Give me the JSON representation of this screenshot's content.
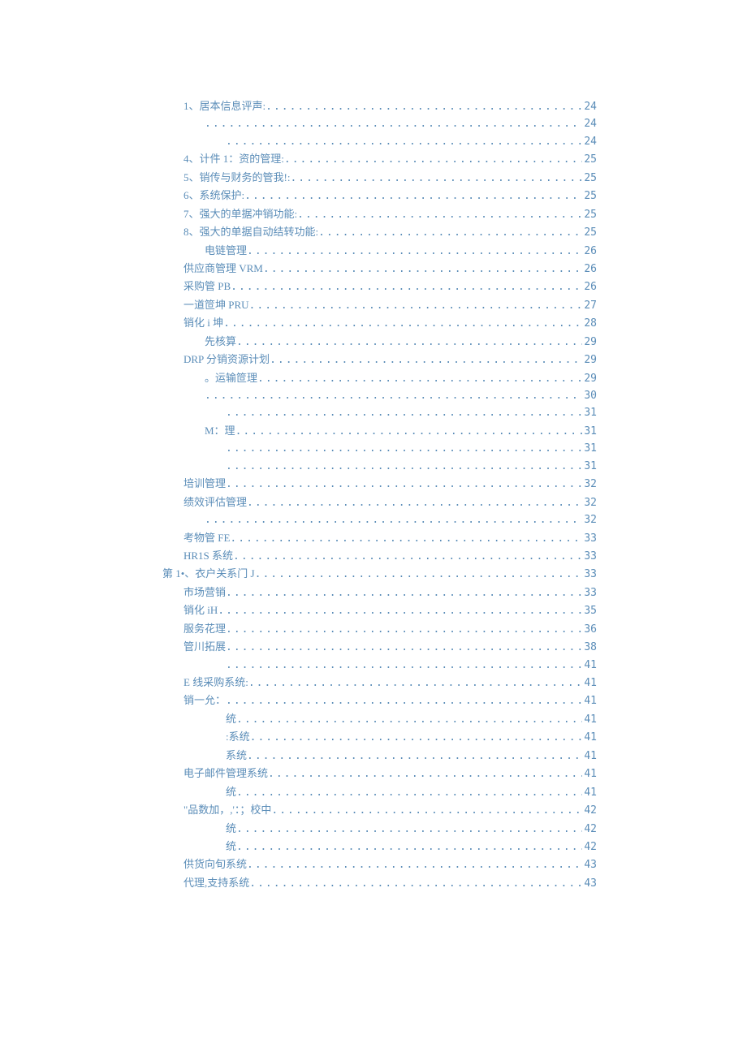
{
  "toc": [
    {
      "label": "1、居本信息评声:",
      "page": "24",
      "indent": 1
    },
    {
      "label": "",
      "page": "24",
      "indent": 2
    },
    {
      "label": "",
      "page": "24",
      "indent": 3
    },
    {
      "label": "4、计件 1：资的管理:",
      "page": "25",
      "indent": 1
    },
    {
      "label": "5、销传与财务的管我!:",
      "page": "25",
      "indent": 1
    },
    {
      "label": "6、系统保护:",
      "page": "25",
      "indent": 1
    },
    {
      "label": "7、强大的单据冲销功能:",
      "page": "25",
      "indent": 1
    },
    {
      "label": "8、强大的单据自动结转功能:",
      "page": "25",
      "indent": 1
    },
    {
      "label": "电链管理",
      "page": "26",
      "indent": 2
    },
    {
      "label": "供应商管理 VRM",
      "page": "26",
      "indent": 1
    },
    {
      "label": "采购管 PB",
      "page": "26",
      "indent": 1
    },
    {
      "label": "一道笸坤 PRU",
      "page": "27",
      "indent": 1
    },
    {
      "label": "销化 i 坤",
      "page": "28",
      "indent": 1
    },
    {
      "label": "先核算",
      "page": "29",
      "indent": 2
    },
    {
      "label": "DRP 分销资源计划",
      "page": "29",
      "indent": 1
    },
    {
      "label": "。运输笸理",
      "page": "29",
      "indent": 2
    },
    {
      "label": "",
      "page": "30",
      "indent": 2
    },
    {
      "label": "",
      "page": "31",
      "indent": 3
    },
    {
      "label": "M：理",
      "page": "31",
      "indent": 2
    },
    {
      "label": "",
      "page": "31",
      "indent": 3
    },
    {
      "label": "",
      "page": "31",
      "indent": 3
    },
    {
      "label": "培训管理",
      "page": "32",
      "indent": 1
    },
    {
      "label": "绩效评估管理",
      "page": "32",
      "indent": 1
    },
    {
      "label": "",
      "page": "32",
      "indent": 2
    },
    {
      "label": "考物管 FE",
      "page": "33",
      "indent": 1
    },
    {
      "label": "HR1S 系统",
      "page": "33",
      "indent": 1
    },
    {
      "label": "第 1•、衣户关系门 J",
      "page": "33",
      "indent": 0
    },
    {
      "label": "市场营销",
      "page": "33",
      "indent": 1
    },
    {
      "label": "销化 iH",
      "page": "35",
      "indent": 1
    },
    {
      "label": "服务花理",
      "page": "36",
      "indent": 1
    },
    {
      "label": "管川拓展",
      "page": "38",
      "indent": 1
    },
    {
      "label": "",
      "page": "41",
      "indent": 3
    },
    {
      "label": "E 线采购系统:",
      "page": "41",
      "indent": 1
    },
    {
      "label": "销一允：",
      "page": "41",
      "indent": 1
    },
    {
      "label": "统",
      "page": "41",
      "indent": 3
    },
    {
      "label": ":系统",
      "page": "41",
      "indent": 3
    },
    {
      "label": "系统",
      "page": "41",
      "indent": 3
    },
    {
      "label": "电子邮件管理系统",
      "page": "41",
      "indent": 1
    },
    {
      "label": "统",
      "page": "41",
      "indent": 3
    },
    {
      "label": "\"品数加，,'：；校中",
      "page": "42",
      "indent": 1
    },
    {
      "label": "统",
      "page": "42",
      "indent": 3
    },
    {
      "label": "统",
      "page": "42",
      "indent": 3
    },
    {
      "label": "供货向旬系统",
      "page": "43",
      "indent": 1
    },
    {
      "label": "代理,支持系统",
      "page": "43",
      "indent": 1
    }
  ]
}
